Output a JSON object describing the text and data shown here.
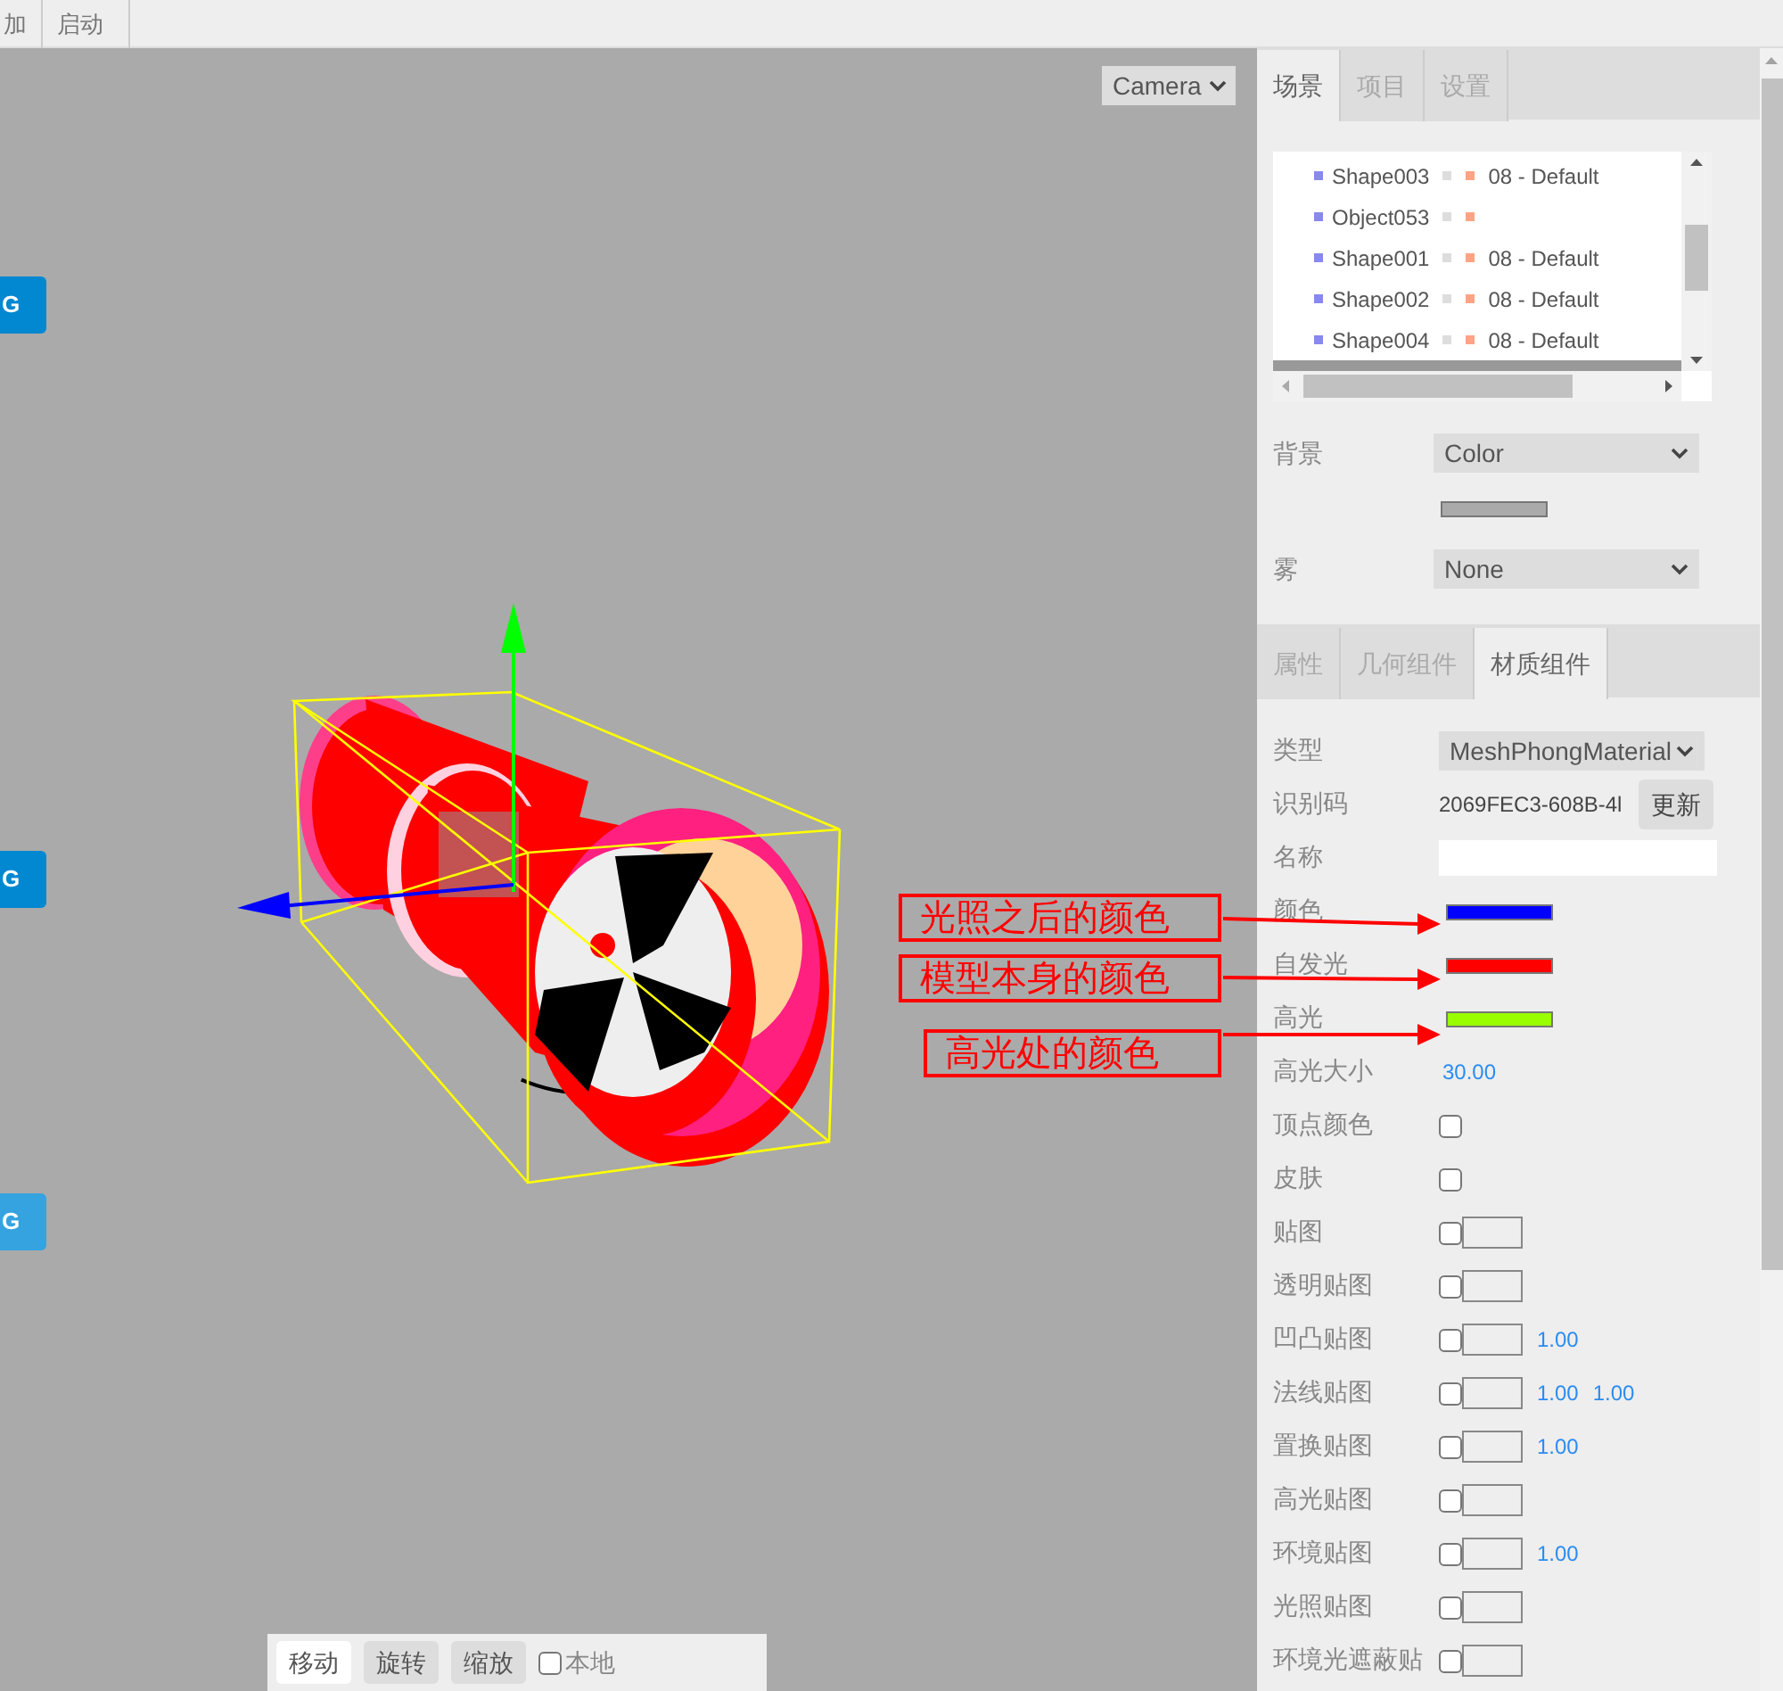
{
  "menu": [
    {
      "label": "加"
    },
    {
      "label": "启动"
    }
  ],
  "viewport": {
    "camera_select": "Camera",
    "export_buttons": [
      {
        "label": "G",
        "color": "#0288d1"
      },
      {
        "label": "G",
        "color": "#0288d1"
      },
      {
        "label": "G",
        "color": "#35a3e0"
      }
    ],
    "annotations": [
      "光照之后的颜色",
      "模型本身的颜色",
      "高光处的颜色"
    ],
    "toolbar": {
      "buttons": [
        {
          "label": "移动",
          "selected": true
        },
        {
          "label": "旋转",
          "selected": false
        },
        {
          "label": "缩放",
          "selected": false
        }
      ],
      "local": {
        "label": "本地",
        "checked": false
      }
    }
  },
  "sidebar": {
    "tabs": [
      {
        "label": "场景",
        "selected": true
      },
      {
        "label": "项目",
        "selected": false
      },
      {
        "label": "设置",
        "selected": false
      }
    ],
    "outliner": {
      "rows": [
        {
          "name": "Shape003",
          "material": "08 - Default",
          "selected": false
        },
        {
          "name": "Object053",
          "selected": false
        },
        {
          "name": "Shape001",
          "material": "08 - Default",
          "selected": false
        },
        {
          "name": "Shape002",
          "material": "08 - Default",
          "selected": false
        },
        {
          "name": "Shape004",
          "material": "08 - Default",
          "selected": false
        },
        {
          "selected": true
        }
      ]
    },
    "background": {
      "label": "背景",
      "value": "Color",
      "color": "#aaaaaa"
    },
    "fog": {
      "label": "雾",
      "value": "None"
    },
    "panel_tabs": [
      {
        "label": "属性",
        "selected": false
      },
      {
        "label": "几何组件",
        "selected": false
      },
      {
        "label": "材质组件",
        "selected": true
      }
    ],
    "properties": [
      {
        "kind": "select",
        "label": "类型",
        "value": "MeshPhongMaterial"
      },
      {
        "kind": "uuid",
        "label": "识别码",
        "value": "2069FEC3-608B-4l",
        "button": "更新"
      },
      {
        "kind": "input",
        "label": "名称"
      },
      {
        "kind": "color",
        "label": "颜色",
        "color": "#0000ff"
      },
      {
        "kind": "color",
        "label": "自发光",
        "color": "#ff0000"
      },
      {
        "kind": "color",
        "label": "高光",
        "color": "#99ff00"
      },
      {
        "kind": "number",
        "label": "高光大小",
        "value": "30.00"
      },
      {
        "kind": "checkbox",
        "label": "顶点颜色",
        "checked": false
      },
      {
        "kind": "checkbox",
        "label": "皮肤",
        "checked": false
      },
      {
        "kind": "map",
        "label": "贴图",
        "checked": false
      },
      {
        "kind": "map",
        "label": "透明贴图",
        "checked": false
      },
      {
        "kind": "map",
        "label": "凹凸贴图",
        "checked": false,
        "values": [
          "1.00"
        ]
      },
      {
        "kind": "map",
        "label": "法线贴图",
        "checked": false,
        "values": [
          "1.00",
          "1.00"
        ]
      },
      {
        "kind": "map",
        "label": "置换贴图",
        "checked": false,
        "values": [
          "1.00"
        ]
      },
      {
        "kind": "map",
        "label": "高光贴图",
        "checked": false
      },
      {
        "kind": "map",
        "label": "环境贴图",
        "checked": false,
        "values": [
          "1.00"
        ]
      },
      {
        "kind": "map",
        "label": "光照贴图",
        "checked": false
      },
      {
        "kind": "map",
        "label": "环境光遮蔽贴",
        "checked": false
      }
    ]
  }
}
